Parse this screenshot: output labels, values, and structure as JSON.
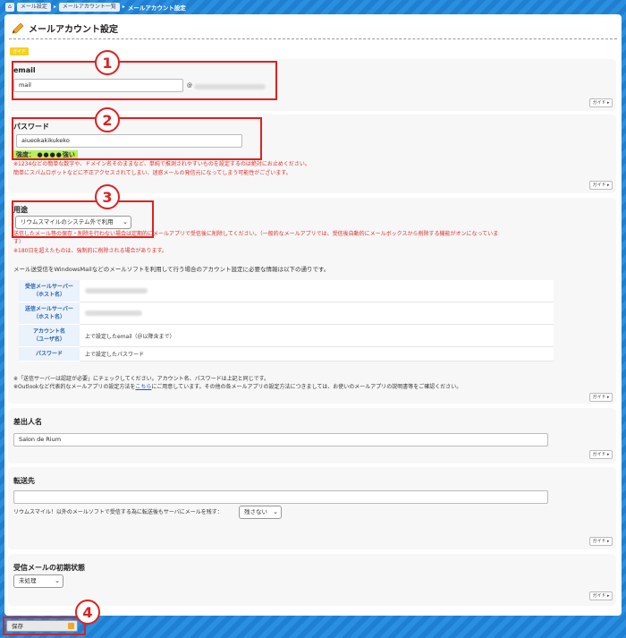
{
  "breadcrumb": {
    "items": [
      "メール設定",
      "メールアカウント一覧"
    ],
    "current": "メールアカウント設定"
  },
  "page": {
    "title": "メールアカウント設定",
    "guide_tag": "ガイド"
  },
  "guide_label": "ガイド ▸",
  "email": {
    "label": "email",
    "value": "mail",
    "at": "@"
  },
  "password": {
    "label": "パスワード",
    "value": "aiueokakikukeko",
    "strength_label": "強度：",
    "strength_dots": "●●●●",
    "strength_word": "強い",
    "warn1": "※1234などの簡単な数字や、ドメイン名そのままなど、単純で推測されやすいものを設定するのは絶対にお止めください。",
    "warn2": "簡単にスパムロボットなどに不正アクセスされてしまい、迷惑メールの発信元になってしまう可能性がございます。"
  },
  "usage": {
    "label": "用途",
    "selected": "リウムスマイルのシステム外で利用",
    "red1": "送信したメール等の保存・削除を行わない場合は定期的にメールアプリで受信後に削除してください。（一般的なメールアプリでは、受信後自動的にメールボックスから削除する機能がオンになっていま",
    "red1b": "す）",
    "red2": "※180日を超えたものは、強制的に削除される場合があります。",
    "intro": "メール送受信をWindowsMailなどのメールソフトを利用して行う場合のアカウント設定に必要な情報は以下の通りです。",
    "table": [
      {
        "h1": "受信メールサーバー",
        "h2": "（ホスト名）",
        "v": ""
      },
      {
        "h1": "送信メールサーバー",
        "h2": "（ホスト名）",
        "v": ""
      },
      {
        "h1": "アカウント名",
        "h2": "（ユーザ名）",
        "v": "上で設定したemail（＠以降含まで）"
      },
      {
        "h1": "パスワード",
        "h2": "",
        "v": "上で設定したパスワード"
      }
    ],
    "foot1": "※「送信サーバーは認証が必要」にチェックしてください。アカウント名、パスワードは上記と同じです。",
    "foot2a": "※Outlookなど代表的なメールアプリの設定方法を",
    "foot2link": "こちら",
    "foot2b": "にご用意しています。その他の各メールアプリの設定方法につきましては、お使いのメールアプリの説明書等をご確認ください。"
  },
  "sender": {
    "label": "差出人名",
    "value": "Salon de Rium"
  },
  "forward": {
    "label": "転送先",
    "value": "",
    "note": "リウムスマイル！以外のメールソフトで受信する為に転送後もサーバにメールを残す：",
    "selected": "残さない"
  },
  "initial": {
    "label": "受信メールの初期状態",
    "selected": "未処理"
  },
  "save": {
    "label": "保存"
  },
  "badges": [
    "1",
    "2",
    "3",
    "4"
  ],
  "colors": {
    "accent": "#e02020",
    "header": "#2a8fe0",
    "strength": "#b6f05a"
  }
}
